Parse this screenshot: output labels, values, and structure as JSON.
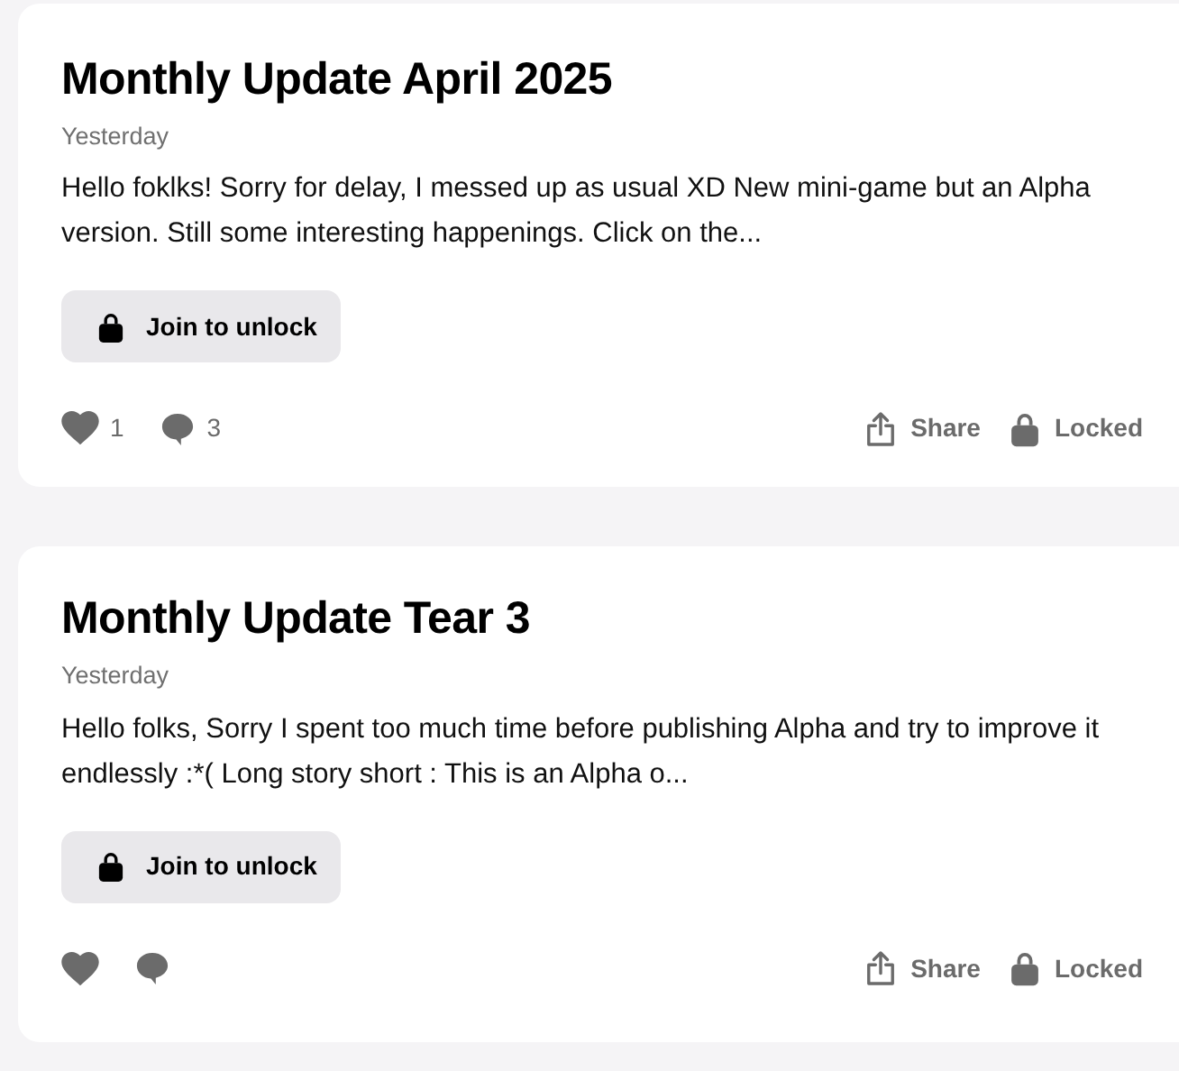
{
  "posts": [
    {
      "title": "Monthly Update April 2025",
      "date": "Yesterday",
      "excerpt": "Hello foklks! Sorry for delay, I messed up as usual XD New mini-game but an Alpha version. Still some interesting happenings. Click on the...",
      "unlock_button": "Join to unlock",
      "likes": "1",
      "comments": "3",
      "share": "Share",
      "status": "Locked"
    },
    {
      "title": "Monthly Update Tear 3",
      "date": "Yesterday",
      "excerpt": "Hello folks, Sorry I spent too much time before publishing Alpha and try to improve it endlessly :*( Long story short : This is an Alpha o...",
      "unlock_button": "Join to unlock",
      "share": "Share",
      "status": "Locked"
    }
  ]
}
